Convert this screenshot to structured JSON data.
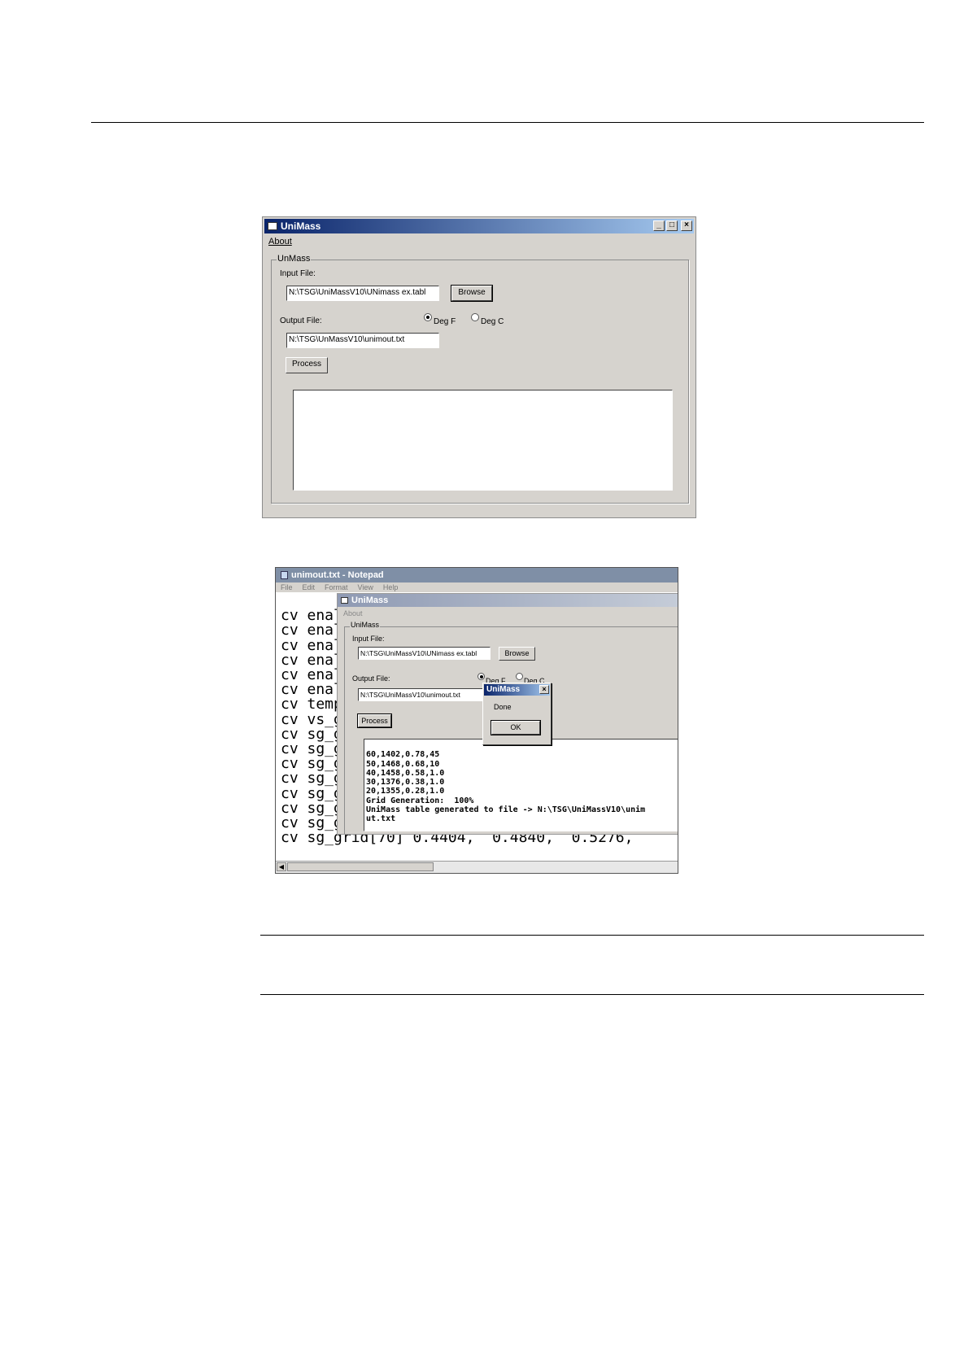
{
  "win1": {
    "title": "UniMass",
    "menu_about": "About",
    "caption_buttons": {
      "minimize": "_",
      "maximize": "□",
      "close": "×"
    },
    "group_label": "UnMass",
    "input_label": "Input File:",
    "input_value": "N:\\TSG\\UniMassV10\\UNimass ex.tabl",
    "browse_label": "Browse",
    "output_label": "Output File:",
    "output_value": "N:\\TSG\\UnMassV10\\unimout.txt",
    "degf_label": "Deg F",
    "degc_label": "Deg C",
    "degf_selected": true,
    "process_label": "Process"
  },
  "notepad": {
    "title": "unimout.txt - Notepad",
    "menu": [
      "File",
      "Edit",
      "Format",
      "View",
      "Help"
    ],
    "lines": [
      "cv enal",
      "cv enal",
      "cv enal",
      "cv enal",
      "cv enal",
      "cv enal",
      "cv temp",
      "cv vs_g",
      "cv sg_g",
      "cv sg_g",
      "cv sg_g",
      "cv sg_g",
      "cv sg_g",
      "cv sg_g",
      "cv sg_g",
      "cv sg_grid[70] 0.4404,  0.4840,  0.5276,"
    ]
  },
  "win2": {
    "title": "UniMass",
    "menu_about": "About",
    "group_label": "UniMass",
    "input_label": "Input File:",
    "input_value": "N:\\TSG\\UniMassV10\\UNimass ex.tabl",
    "browse_label": "Browse",
    "output_label": "Output File:",
    "output_value": "N:\\TSG\\UniMassV10\\unimout.txt",
    "degf_label": "Deg F",
    "degc_label": "Deg C",
    "process_label": "Process",
    "log_lines": [
      "60,1402,0.78,45",
      "50,1468,0.68,10",
      "40,1458,0.58,1.0",
      "30,1376,0.38,1.0",
      "20,1355,0.28,1.0",
      "Grid Generation:  100%",
      "UniMass table generated to file -> N:\\TSG\\UniMassV10\\unim",
      "ut.txt"
    ]
  },
  "dialog": {
    "title": "UniMass",
    "message": "Done",
    "ok_label": "OK",
    "close": "×"
  }
}
